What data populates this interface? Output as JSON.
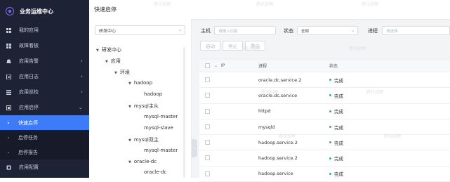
{
  "sidebar": {
    "brand": "业务运维中心",
    "items": [
      {
        "label": "我的应用",
        "icon": "grid-icon",
        "chevron": ""
      },
      {
        "label": "故障看板",
        "icon": "dashboard-icon",
        "chevron": ""
      },
      {
        "label": "应用告警",
        "icon": "bell-icon",
        "chevron": "›"
      },
      {
        "label": "应用日志",
        "icon": "log-icon",
        "chevron": "›"
      },
      {
        "label": "应用巡检",
        "icon": "inspect-icon",
        "chevron": "›"
      },
      {
        "label": "应用启停",
        "icon": "power-icon",
        "chevron": "⌄"
      }
    ],
    "subitems": [
      {
        "label": "快速启停",
        "active": true
      },
      {
        "label": "启停任务",
        "active": false
      },
      {
        "label": "启停报告",
        "active": false
      }
    ],
    "bottom_item": {
      "label": "应用配置",
      "icon": "config-icon"
    }
  },
  "topbar": {
    "title": "快速启停"
  },
  "tree": {
    "select_value": "研发中心",
    "nodes": [
      {
        "label": "研发中心",
        "toggle": "▼"
      },
      {
        "label": "应用",
        "toggle": "▼"
      },
      {
        "label": "环境",
        "toggle": "▼"
      },
      {
        "label": "hadoop",
        "toggle": "▼"
      },
      {
        "label": "hadoop",
        "toggle": ""
      },
      {
        "label": "mysql主从",
        "toggle": "▼"
      },
      {
        "label": "mysql-master",
        "toggle": ""
      },
      {
        "label": "mysql-slave",
        "toggle": ""
      },
      {
        "label": "mysql双主",
        "toggle": "▼"
      },
      {
        "label": "mysql-master",
        "toggle": ""
      },
      {
        "label": "oracle-dc",
        "toggle": "▼"
      },
      {
        "label": "oracle-dc",
        "toggle": ""
      }
    ]
  },
  "filters": {
    "host_label": "主机",
    "host_placeholder": "请输入内容",
    "status_label": "状态",
    "status_value": "全部",
    "process_label": "进程",
    "process_placeholder": "请选择"
  },
  "actions": {
    "start": "启动",
    "stop": "停止",
    "restart": "重启"
  },
  "table": {
    "columns": {
      "ip": "IP",
      "process": "进程",
      "status": "状态"
    },
    "sort_icon": "⌄",
    "rows": [
      {
        "ip": "",
        "process": "oracle.dc.service.2",
        "status": "完成"
      },
      {
        "ip": "",
        "process": "oracle.dc.service",
        "status": "完成"
      },
      {
        "ip": "",
        "process": "httpd",
        "status": "完成"
      },
      {
        "ip": "",
        "process": "mysqld",
        "status": "完成"
      },
      {
        "ip": "",
        "process": "hadoop.service.2",
        "status": "完成"
      },
      {
        "ip": "",
        "process": "hadoop.service.2",
        "status": "完成"
      },
      {
        "ip": "",
        "process": "hadoop.service",
        "status": "完成"
      }
    ]
  },
  "watermark": "腾讯招聘",
  "colors": {
    "sidebar_bg": "#1e2235",
    "active": "#3d7bf7",
    "success": "#2bb673"
  }
}
